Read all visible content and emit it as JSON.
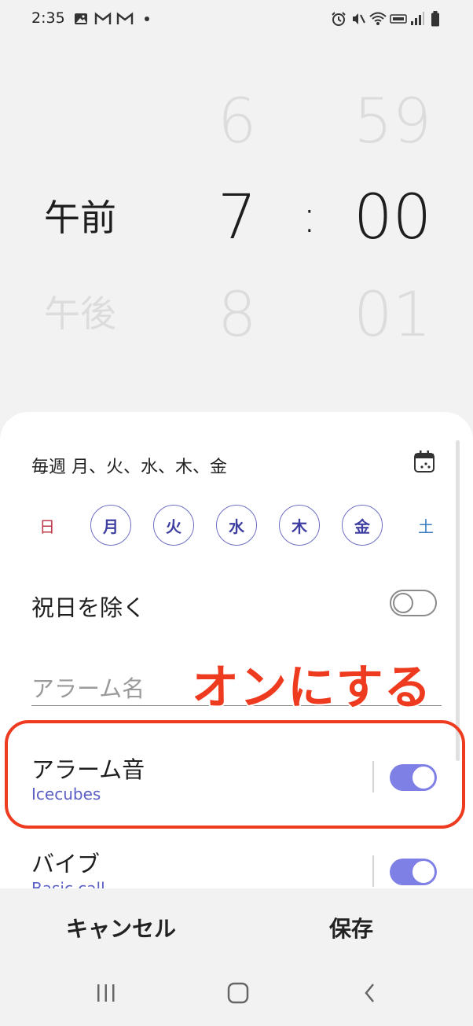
{
  "status_bar": {
    "time": "2:35",
    "left_icons": [
      "gallery-icon",
      "gmail-icon",
      "gmail-icon",
      "dot-icon"
    ],
    "right_icons": [
      "alarm-icon",
      "mute-vibrate-icon",
      "wifi-icon",
      "volte-icon",
      "signal-icon",
      "battery-icon"
    ]
  },
  "picker": {
    "ampm_selected": "午前",
    "ampm_next": "午後",
    "hour_prev": "6",
    "hour_selected": "7",
    "hour_next": "8",
    "separator": ":",
    "minute_prev": "59",
    "minute_selected": "00",
    "minute_next": "01"
  },
  "repeat": {
    "summary": "毎週 月、火、水、木、金",
    "days": [
      {
        "label": "日",
        "selected": false
      },
      {
        "label": "月",
        "selected": true
      },
      {
        "label": "火",
        "selected": true
      },
      {
        "label": "水",
        "selected": true
      },
      {
        "label": "木",
        "selected": true
      },
      {
        "label": "金",
        "selected": true
      },
      {
        "label": "土",
        "selected": false
      }
    ]
  },
  "exclude_holidays": {
    "label": "祝日を除く",
    "enabled": false
  },
  "alarm_name": {
    "placeholder": "アラーム名",
    "value": ""
  },
  "alarm_sound": {
    "label": "アラーム音",
    "value": "Icecubes",
    "enabled": true
  },
  "vibration": {
    "label": "バイブ",
    "value": "Basic call",
    "enabled": true
  },
  "annotation": {
    "text": "オンにする",
    "color": "#ee3a1f"
  },
  "actions": {
    "cancel": "キャンセル",
    "save": "保存"
  },
  "nav": [
    "recents-icon",
    "home-icon",
    "back-icon"
  ],
  "colors": {
    "accent": "#7f80e6",
    "sunday": "#c0394b",
    "saturday": "#3b7dc4"
  }
}
